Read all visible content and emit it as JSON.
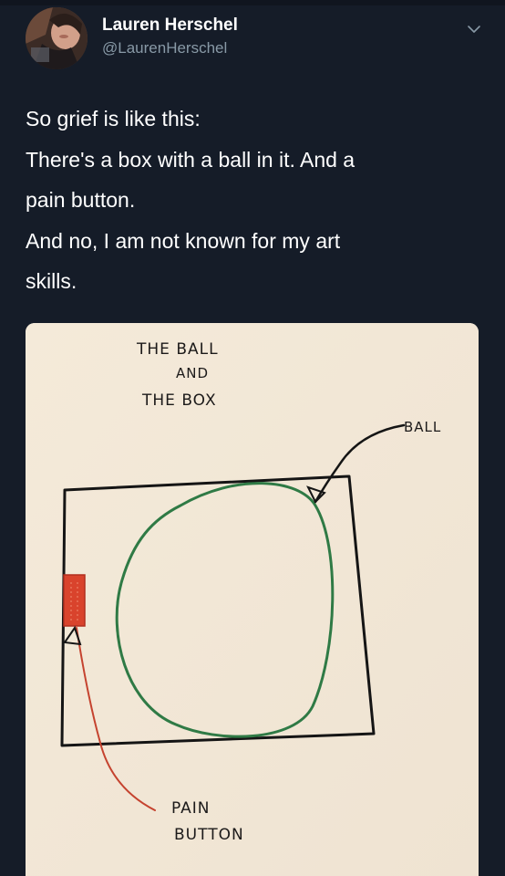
{
  "tweet": {
    "author": {
      "display_name": "Lauren Herschel",
      "handle": "@LaurenHerschel"
    },
    "menu_icon": "chevron-down-icon",
    "text_lines": [
      "So grief is like this:",
      "There's a box with a ball in it. And a",
      "pain button.",
      "And no, I am not known for my art",
      "skills."
    ]
  },
  "drawing": {
    "title_lines": [
      "THE BALL",
      "AND",
      "THE BOX"
    ],
    "ball_label": "BALL",
    "button_label_lines": [
      "PAIN",
      "BUTTON"
    ],
    "colors": {
      "paper": "#f2e8d9",
      "box_ink": "#151515",
      "ball_ink": "#2f7a45",
      "button_red": "#d9432c",
      "pointer_red": "#c5432f"
    }
  }
}
